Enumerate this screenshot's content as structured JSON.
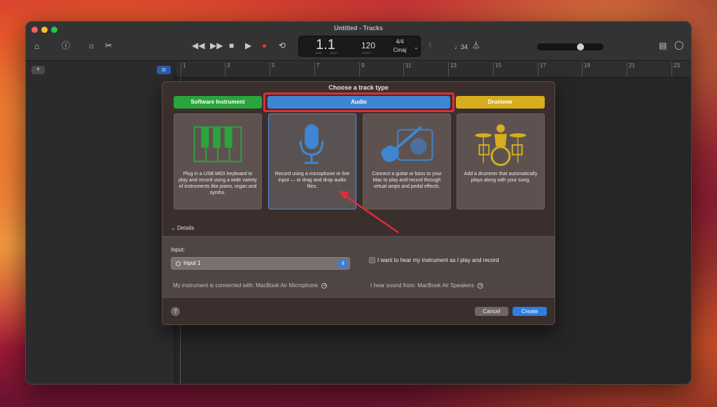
{
  "window": {
    "title": "Untitled - Tracks"
  },
  "lcd": {
    "position": "1.1",
    "bar_label": "BAR",
    "beat_label": "BEAT",
    "tempo": "120",
    "tempo_label": "TEMPO",
    "time_signature": "4/4",
    "key": "Cmaj"
  },
  "toolbar": {
    "count_in": "♩34"
  },
  "ruler": {
    "ticks": [
      "1",
      "3",
      "5",
      "7",
      "9",
      "11",
      "13",
      "15",
      "17",
      "19",
      "21",
      "23"
    ]
  },
  "dialog": {
    "title": "Choose a track type",
    "tabs": {
      "software_instrument": "Software Instrument",
      "audio": "Audio",
      "drummer": "Drummer"
    },
    "cards": {
      "software_instrument": "Plug in a USB MIDI keyboard to play and record using a wide variety of instruments like piano, organ and synths.",
      "audio": "Record using a microphone or line input — or drag and drop audio files.",
      "guitar": "Connect a guitar or bass to your Mac to play and record through virtual amps and pedal effects.",
      "drummer": "Add a drummer that automatically plays along with your song."
    },
    "details_label": "Details",
    "input_label": "Input:",
    "input_value": "Input 1",
    "monitor_label": "I want to hear my instrument as I play and record",
    "connected_with": "My instrument is connected with: MacBook Air Microphone",
    "hear_from": "I hear sound from: MacBook Air Speakers",
    "help": "?",
    "cancel": "Cancel",
    "create": "Create"
  },
  "colors": {
    "software_instrument": "#2aa43c",
    "audio": "#3f86d2",
    "drummer": "#d6ae1e",
    "highlight": "#e22b3a",
    "create_button": "#2f7de0"
  }
}
